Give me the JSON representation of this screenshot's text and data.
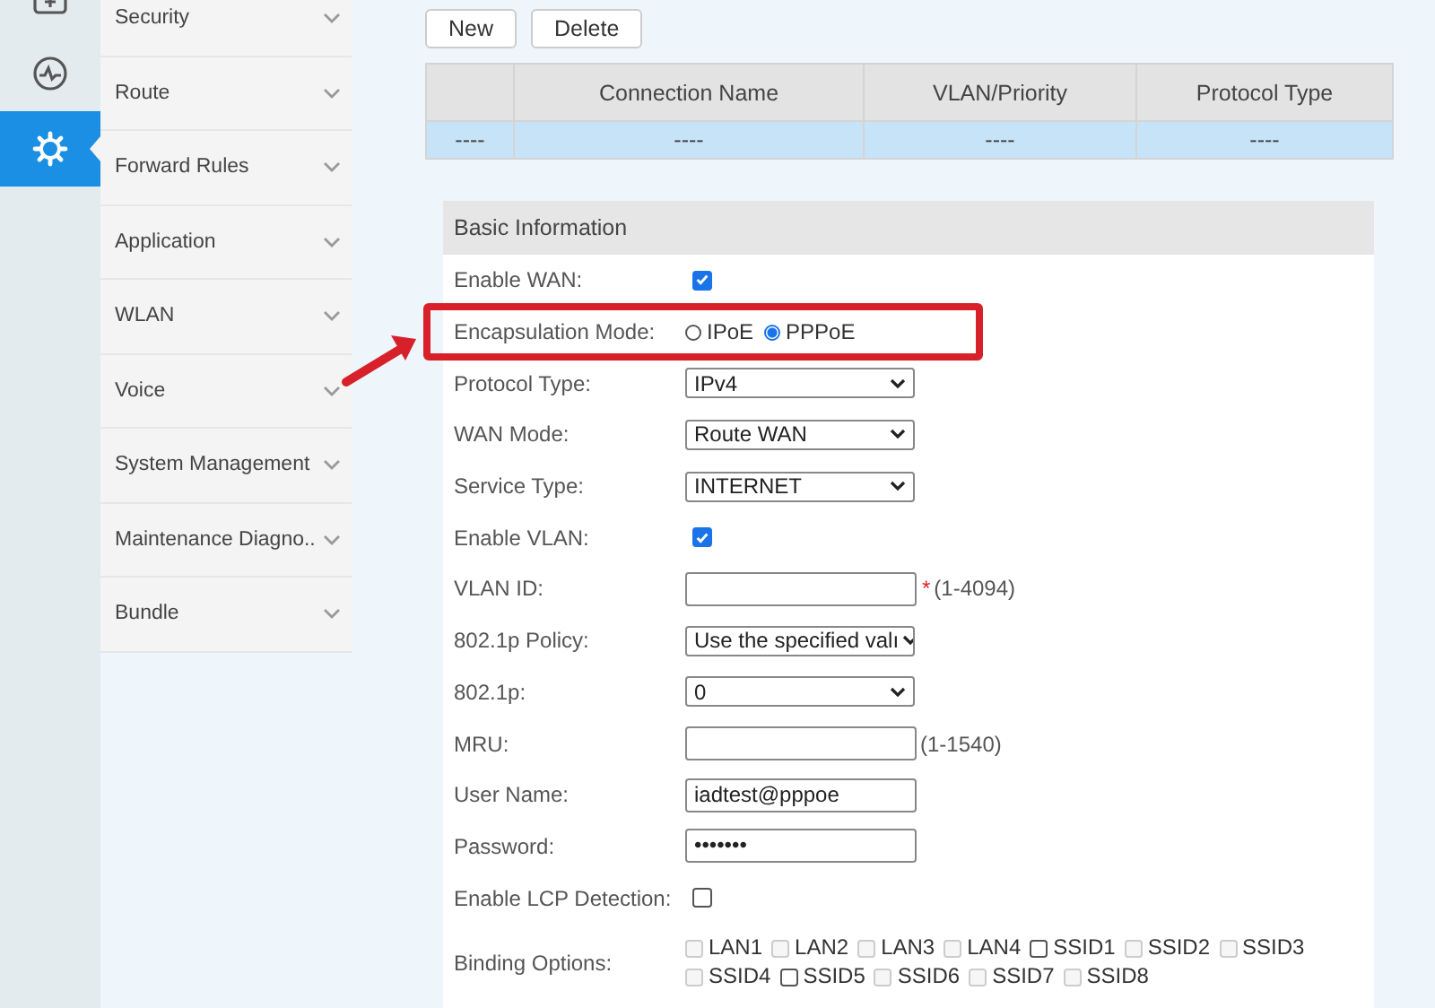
{
  "rail": [
    {
      "selected": false
    },
    {
      "selected": false
    },
    {
      "selected": true
    }
  ],
  "menu": [
    "Security",
    "Route",
    "Forward Rules",
    "Application",
    "WLAN",
    "Voice",
    "System Management",
    "Maintenance Diagno..",
    "Bundle"
  ],
  "buttons": [
    "New",
    "Delete"
  ],
  "table": {
    "columns": [
      "",
      "Connection Name",
      "VLAN/Priority",
      "Protocol Type"
    ],
    "rows": [
      [
        "----",
        "----",
        "----",
        "----"
      ]
    ]
  },
  "form": {
    "title": "Basic Information",
    "rows": [
      {
        "kind": "checkbox",
        "label": "Enable WAN:",
        "checked": true
      },
      {
        "kind": "radio",
        "label": "Encapsulation Mode:",
        "highlighted": true,
        "options": [
          {
            "label": "IPoE",
            "selected": false
          },
          {
            "label": "PPPoE",
            "selected": true
          }
        ]
      },
      {
        "kind": "select",
        "label": "Protocol Type:",
        "value": "IPv4"
      },
      {
        "kind": "select",
        "label": "WAN Mode:",
        "value": "Route WAN"
      },
      {
        "kind": "select",
        "label": "Service Type:",
        "value": "INTERNET"
      },
      {
        "kind": "checkbox",
        "label": "Enable VLAN:",
        "checked": true
      },
      {
        "kind": "input",
        "label": "VLAN ID:",
        "mark": "*",
        "hint": "(1-4094)"
      },
      {
        "kind": "select",
        "label": "802.1p Policy:",
        "value": "Use the specified valı"
      },
      {
        "kind": "select",
        "label": "802.1p:",
        "value": "0"
      },
      {
        "kind": "input",
        "label": "MRU:",
        "hint": "(1-1540)"
      },
      {
        "kind": "input",
        "label": "User Name:",
        "value": "iadtest@pppoe"
      },
      {
        "kind": "input",
        "label": "Password:",
        "value": "•••••••"
      },
      {
        "kind": "checkbox",
        "label": "Enable LCP Detection:",
        "checked": false
      },
      {
        "kind": "options",
        "label": "Binding Options:",
        "options": [
          {
            "label": "LAN1",
            "checked": false,
            "disabled": true
          },
          {
            "label": "LAN2",
            "checked": false,
            "disabled": true
          },
          {
            "label": "LAN3",
            "checked": false,
            "disabled": true
          },
          {
            "label": "LAN4",
            "checked": false,
            "disabled": true
          },
          {
            "label": "SSID1",
            "checked": false,
            "disabled": false
          },
          {
            "label": "SSID2",
            "checked": false,
            "disabled": true
          },
          {
            "label": "SSID3",
            "checked": false,
            "disabled": true
          },
          {
            "label": "SSID4",
            "checked": false,
            "disabled": true
          },
          {
            "label": "SSID5",
            "checked": false,
            "disabled": false
          },
          {
            "label": "SSID6",
            "checked": false,
            "disabled": true
          },
          {
            "label": "SSID7",
            "checked": false,
            "disabled": true
          },
          {
            "label": "SSID8",
            "checked": false,
            "disabled": true
          }
        ]
      }
    ]
  }
}
